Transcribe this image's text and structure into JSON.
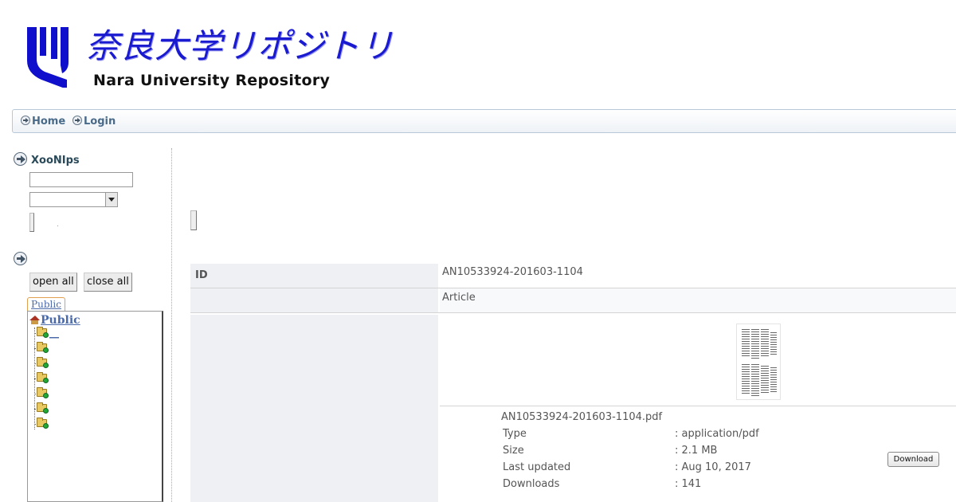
{
  "header": {
    "title_jp": "奈良大学リポジトリ",
    "title_en": "Nara University Repository",
    "logo_color": "#1a1ad0"
  },
  "nav": {
    "items": [
      {
        "label": "Home",
        "icon": "arrow-right-icon"
      },
      {
        "label": "Login",
        "icon": "arrow-right-icon"
      }
    ]
  },
  "sidebar": {
    "search_block_title": "XooNIps",
    "search_input_value": "",
    "search_select_value": "",
    "tree_block_title": "",
    "tree_buttons": {
      "open_all": "open all",
      "close_all": "close all"
    },
    "tab_label": "Public",
    "tree_root_label": "Public",
    "tree_nodes": [
      {
        "label": "__"
      },
      {
        "label": ""
      },
      {
        "label": ""
      },
      {
        "label": ""
      },
      {
        "label": ""
      },
      {
        "label": ""
      },
      {
        "label": ""
      }
    ]
  },
  "detail": {
    "rows": [
      {
        "label": "ID",
        "value": "AN10533924-201603-1104"
      },
      {
        "label": "",
        "value": "Article"
      }
    ],
    "file": {
      "name": "AN10533924-201603-1104.pdf",
      "type_label": "Type",
      "type_value": ": application/pdf",
      "size_label": "Size",
      "size_value": ": 2.1 MB",
      "updated_label": "Last updated",
      "updated_value": ": Aug 10, 2017",
      "downloads_label": "Downloads",
      "downloads_value": ": 141",
      "download_button": "Download"
    }
  }
}
